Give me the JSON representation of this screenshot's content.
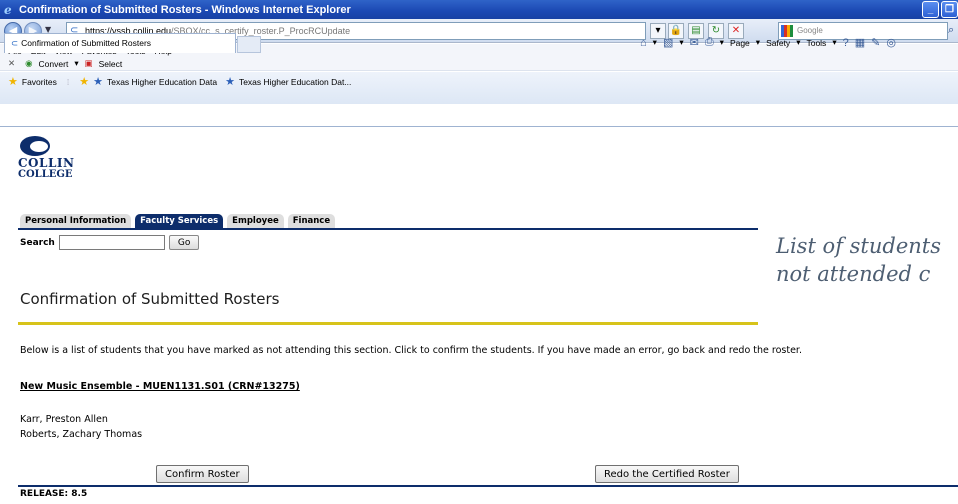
{
  "window": {
    "title": "Confirmation of Submitted Rosters - Windows Internet Explorer",
    "buttons": [
      "_",
      "❐"
    ]
  },
  "address": {
    "host": "https://vssb.collin.edu",
    "path": "/SBOX/cc_s_certify_roster.P_ProcRCUpdate",
    "search_placeholder": "Google"
  },
  "menu": [
    "File",
    "Edit",
    "View",
    "Favorites",
    "Tools",
    "Help"
  ],
  "toolbar": {
    "convert": "Convert",
    "select": "Select"
  },
  "favorites": {
    "label": "Favorites",
    "items": [
      "Texas Higher Education Data",
      "Texas Higher Education Dat..."
    ]
  },
  "tab": {
    "label": "Confirmation of Submitted Rosters"
  },
  "commands": [
    "Page",
    "Safety",
    "Tools"
  ],
  "logo": {
    "line1": "COLLIN",
    "line2": "COLLEGE"
  },
  "nav_tabs": [
    {
      "label": "Personal Information",
      "active": false
    },
    {
      "label": "Faculty Services",
      "active": true
    },
    {
      "label": "Employee",
      "active": false
    },
    {
      "label": "Finance",
      "active": false
    }
  ],
  "search": {
    "label": "Search",
    "value": "",
    "go": "Go"
  },
  "overlay": {
    "line1": "List of students",
    "line2": "not attended c"
  },
  "page": {
    "heading": "Confirmation of Submitted Rosters",
    "instructions": "Below is a list of students that you have marked as not attending this section. Click to confirm the students. If you have made an error, go back and redo the roster.",
    "course": "New Music Ensemble - MUEN1131.S01 (CRN#13275)",
    "students": [
      "Karr, Preston Allen",
      "Roberts, Zachary Thomas"
    ],
    "confirm_button": "Confirm Roster",
    "redo_button": "Redo the Certified Roster",
    "release": "RELEASE: 8.5"
  },
  "colors": {
    "brand_navy": "#0d2d6b",
    "gold_rule": "#d7c31a",
    "ie_title_blue": "#1b48b3"
  }
}
